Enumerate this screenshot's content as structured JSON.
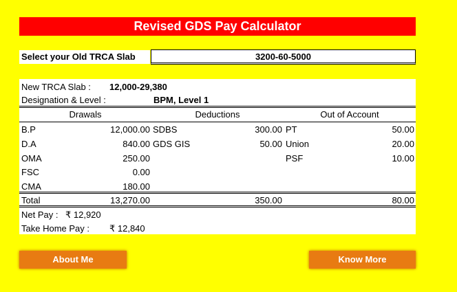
{
  "title": "Revised GDS Pay Calculator",
  "select": {
    "label": "Select your Old TRCA Slab",
    "value": "3200-60-5000"
  },
  "info": {
    "trca_label": "New TRCA Slab :",
    "trca_value": "12,000-29,380",
    "designation_label": "Designation & Level :",
    "designation_value": "BPM, Level 1"
  },
  "headers": {
    "drawals": "Drawals",
    "deductions": "Deductions",
    "out_of_account": "Out of Account"
  },
  "rows": [
    {
      "d_label": "B.P",
      "d_value": "12,000.00",
      "x_label": "SDBS",
      "x_value": "300.00",
      "o_label": "PT",
      "o_value": "50.00"
    },
    {
      "d_label": "D.A",
      "d_value": "840.00",
      "x_label": "GDS GIS",
      "x_value": "50.00",
      "o_label": "Union",
      "o_value": "20.00"
    },
    {
      "d_label": "OMA",
      "d_value": "250.00",
      "x_label": "",
      "x_value": "",
      "o_label": "PSF",
      "o_value": "10.00"
    },
    {
      "d_label": "FSC",
      "d_value": "0.00",
      "x_label": "",
      "x_value": "",
      "o_label": "",
      "o_value": ""
    },
    {
      "d_label": "CMA",
      "d_value": "180.00",
      "x_label": "",
      "x_value": "",
      "o_label": "",
      "o_value": ""
    }
  ],
  "total": {
    "label": "Total",
    "drawals": "13,270.00",
    "deductions": "350.00",
    "out_of_account": "80.00"
  },
  "net_pay": {
    "label": "Net Pay :",
    "value": "₹ 12,920"
  },
  "take_home": {
    "label": "Take Home Pay :",
    "value": "₹ 12,840"
  },
  "buttons": {
    "about": "About Me",
    "know_more": "Know More"
  }
}
